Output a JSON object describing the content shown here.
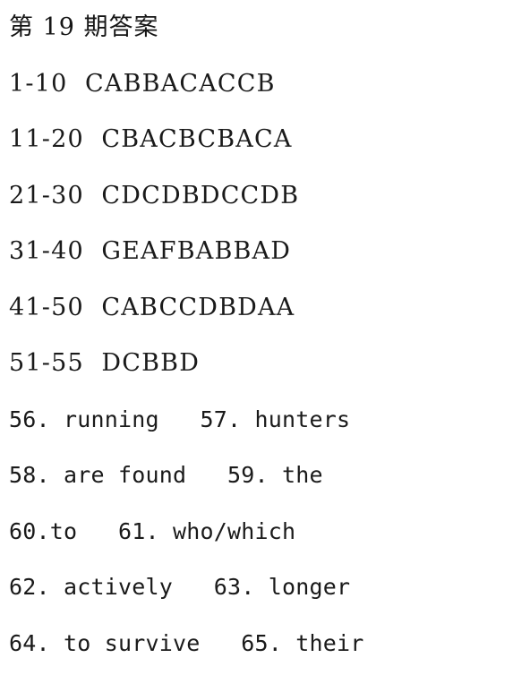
{
  "document": {
    "title": "第 19 期答案",
    "background_color": "#ffffff",
    "text_color": "#1a1a1a",
    "lines": [
      {
        "id": "title",
        "kind": "title",
        "text": "第 19 期答案"
      },
      {
        "id": "range-1-10",
        "kind": "answers",
        "text": "1-10  CABBACACCB"
      },
      {
        "id": "range-11-20",
        "kind": "answers",
        "text": "11-20  CBACBCBACA"
      },
      {
        "id": "range-21-30",
        "kind": "answers",
        "text": "21-30  CDCDBDCCDB"
      },
      {
        "id": "range-31-40",
        "kind": "answers",
        "text": "31-40  GEAFBABBAD"
      },
      {
        "id": "range-41-50",
        "kind": "answers",
        "text": "41-50  CABCCDBDAA"
      },
      {
        "id": "range-51-55",
        "kind": "answers",
        "text": "51-55  DCBBD"
      },
      {
        "id": "items-56-57",
        "kind": "fill",
        "text": "56. running   57. hunters"
      },
      {
        "id": "items-58-59",
        "kind": "fill",
        "text": "58. are found   59. the"
      },
      {
        "id": "items-60-61",
        "kind": "fill",
        "text": "60.to   61. who/which"
      },
      {
        "id": "items-62-63",
        "kind": "fill",
        "text": "62. actively   63. longer"
      },
      {
        "id": "items-64-65",
        "kind": "fill",
        "text": "64. to survive   65. their"
      }
    ],
    "answer_key": {
      "multiple_choice": [
        {
          "range": "1-10",
          "answers": "CABBACACCB"
        },
        {
          "range": "11-20",
          "answers": "CBACBCBACA"
        },
        {
          "range": "21-30",
          "answers": "CDCDBDCCDB"
        },
        {
          "range": "31-40",
          "answers": "GEAFBABBAD"
        },
        {
          "range": "41-50",
          "answers": "CABCCDBDAA"
        },
        {
          "range": "51-55",
          "answers": "DCBBD"
        }
      ],
      "fill_in_blanks": [
        {
          "number": "56",
          "answer": "running"
        },
        {
          "number": "57",
          "answer": "hunters"
        },
        {
          "number": "58",
          "answer": "are found"
        },
        {
          "number": "59",
          "answer": "the"
        },
        {
          "number": "60",
          "answer": "to"
        },
        {
          "number": "61",
          "answer": "who/which"
        },
        {
          "number": "62",
          "answer": "actively"
        },
        {
          "number": "63",
          "answer": "longer"
        },
        {
          "number": "64",
          "answer": "to survive"
        },
        {
          "number": "65",
          "answer": "their"
        }
      ]
    }
  }
}
